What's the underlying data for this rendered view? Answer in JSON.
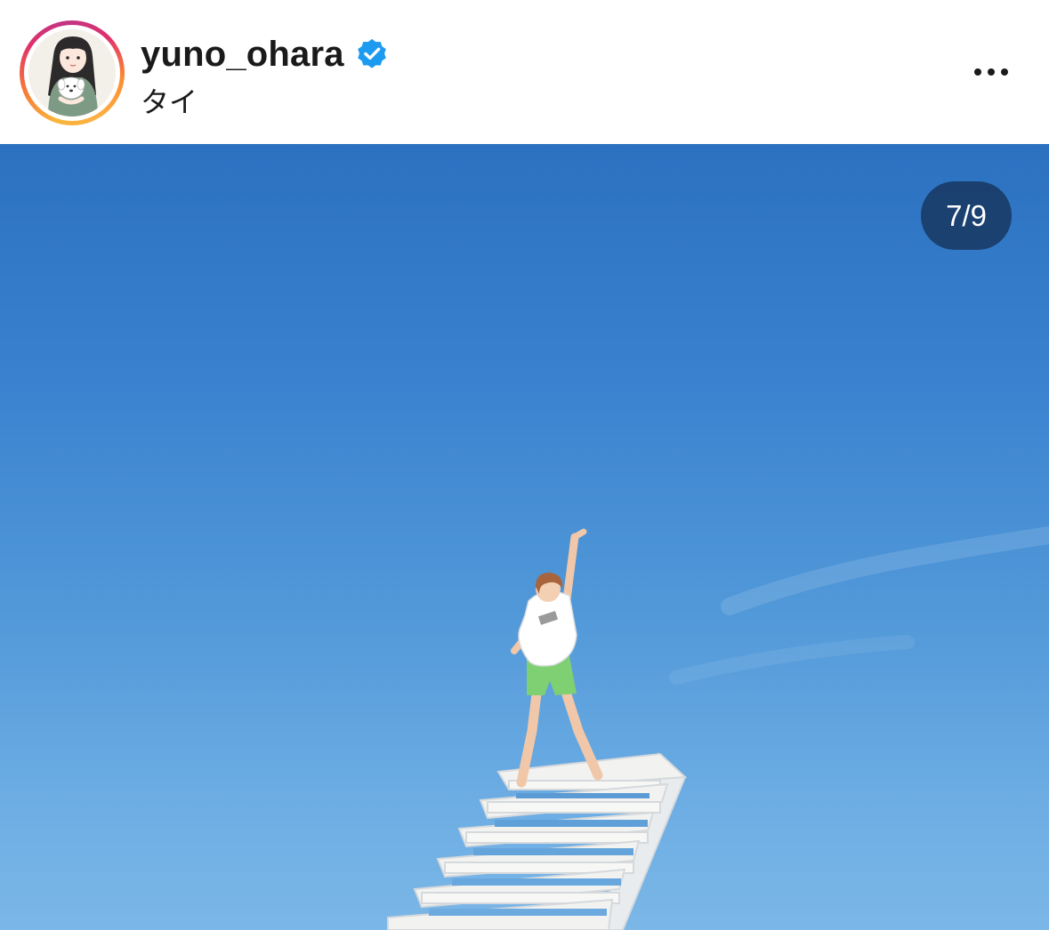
{
  "post_header": {
    "username": "yuno_ohara",
    "verified_icon": "verified-badge-icon",
    "location": "タイ",
    "more_icon": "more-options-icon"
  },
  "media": {
    "carousel_counter": "7/9",
    "current_index": 7,
    "total": 9
  },
  "colors": {
    "verified_badge": "#1d9bf0",
    "sky_top": "#2b71c0",
    "sky_bottom": "#7bb7e7",
    "counter_background": "#163258"
  }
}
